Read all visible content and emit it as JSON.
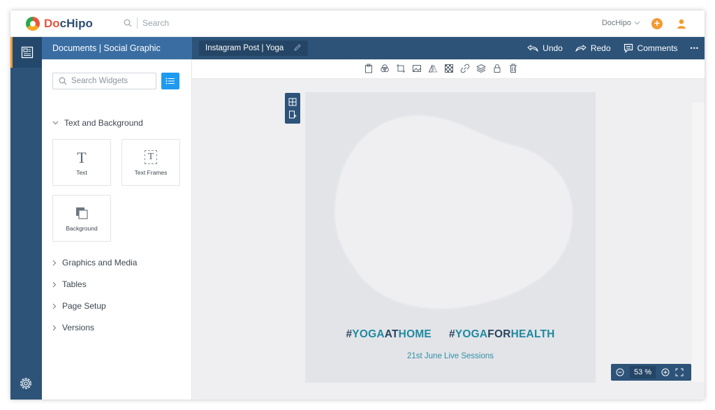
{
  "app": {
    "logo_prefix": "Do",
    "logo_suffix": "cHipo",
    "search_placeholder": "Search",
    "user_name": "DocHipo",
    "add_label": "+"
  },
  "panel": {
    "header": "Documents | Social Graphic",
    "search_placeholder": "Search Widgets",
    "section_text_bg": "Text and Background",
    "tiles": [
      {
        "label": "Text",
        "icon": "text-icon"
      },
      {
        "label": "Text Frames",
        "icon": "text-frame-icon"
      },
      {
        "label": "Background",
        "icon": "background-icon"
      }
    ],
    "sections": [
      "Graphics and Media",
      "Tables",
      "Page Setup",
      "Versions"
    ]
  },
  "doc": {
    "name": "Instagram Post | Yoga",
    "undo": "Undo",
    "redo": "Redo",
    "comments": "Comments",
    "more": "•••"
  },
  "toolbar": [
    "clipboard-icon",
    "filter-icon",
    "crop-icon",
    "image-icon",
    "flip-icon",
    "transparency-icon",
    "link-icon",
    "layers-icon",
    "lock-icon",
    "delete-icon"
  ],
  "canvas": {
    "hashtag1_hash": "#",
    "hashtag1_a": "YOGA",
    "hashtag1_b": "AT",
    "hashtag1_c": "HOME",
    "hashtag2_hash": "#",
    "hashtag2_a": "YOGA",
    "hashtag2_b": "FOR",
    "hashtag2_c": "HEALTH",
    "subtitle": "21st June Live Sessions",
    "background_color": "#e3e4e8",
    "blob_color": "#efeff2"
  },
  "zoom": {
    "value": "53 %"
  },
  "colors": {
    "navy": "#2d5379",
    "accent_orange": "#f29b35",
    "accent_blue": "#1e9af0",
    "teal": "#1f8aa0"
  }
}
